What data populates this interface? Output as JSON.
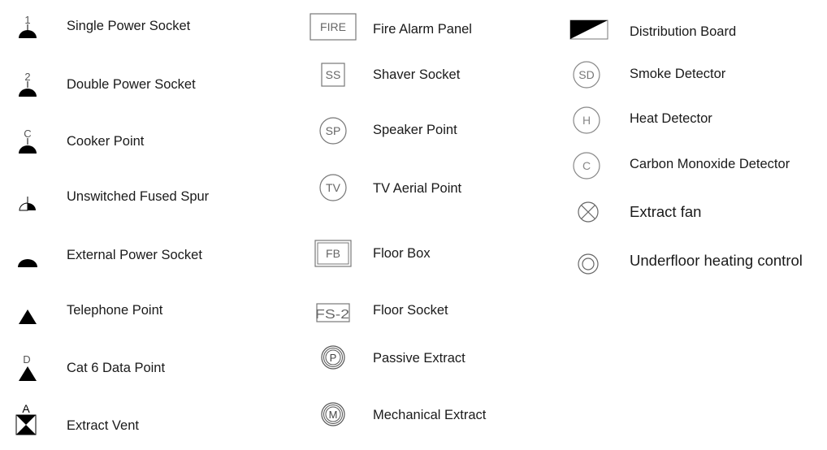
{
  "legend": {
    "column1": [
      {
        "symbol": "single-power-socket",
        "marker": "1",
        "label": "Single Power Socket"
      },
      {
        "symbol": "double-power-socket",
        "marker": "2",
        "label": "Double Power Socket"
      },
      {
        "symbol": "cooker-point",
        "marker": "C",
        "label": "Cooker Point"
      },
      {
        "symbol": "unswitched-fused-spur",
        "marker": "",
        "label": "Unswitched Fused Spur"
      },
      {
        "symbol": "external-power-socket",
        "marker": "",
        "label": "External Power Socket"
      },
      {
        "symbol": "telephone-point",
        "marker": "",
        "label": "Telephone Point"
      },
      {
        "symbol": "cat6-data-point",
        "marker": "D",
        "label": "Cat 6 Data Point"
      },
      {
        "symbol": "extract-vent",
        "marker": "A",
        "label": "Extract Vent"
      }
    ],
    "column2": [
      {
        "symbol": "fire-alarm-panel",
        "marker": "FIRE",
        "label": "Fire Alarm Panel"
      },
      {
        "symbol": "shaver-socket",
        "marker": "SS",
        "label": "Shaver Socket"
      },
      {
        "symbol": "speaker-point",
        "marker": "SP",
        "label": "Speaker Point"
      },
      {
        "symbol": "tv-aerial-point",
        "marker": "TV",
        "label": "TV Aerial Point"
      },
      {
        "symbol": "floor-box",
        "marker": "FB",
        "label": "Floor Box"
      },
      {
        "symbol": "floor-socket",
        "marker": "FS-2",
        "label": "Floor Socket"
      },
      {
        "symbol": "passive-extract",
        "marker": "P",
        "label": "Passive Extract"
      },
      {
        "symbol": "mechanical-extract",
        "marker": "M",
        "label": "Mechanical Extract"
      }
    ],
    "column3": [
      {
        "symbol": "distribution-board",
        "marker": "",
        "label": "Distribution Board"
      },
      {
        "symbol": "smoke-detector",
        "marker": "SD",
        "label": "Smoke Detector"
      },
      {
        "symbol": "heat-detector",
        "marker": "H",
        "label": "Heat Detector"
      },
      {
        "symbol": "carbon-monoxide-detector",
        "marker": "C",
        "label": "Carbon Monoxide Detector"
      },
      {
        "symbol": "extract-fan",
        "marker": "",
        "label": "Extract fan"
      },
      {
        "symbol": "underfloor-heating-control",
        "marker": "",
        "label": "Underfloor heating control"
      }
    ]
  }
}
